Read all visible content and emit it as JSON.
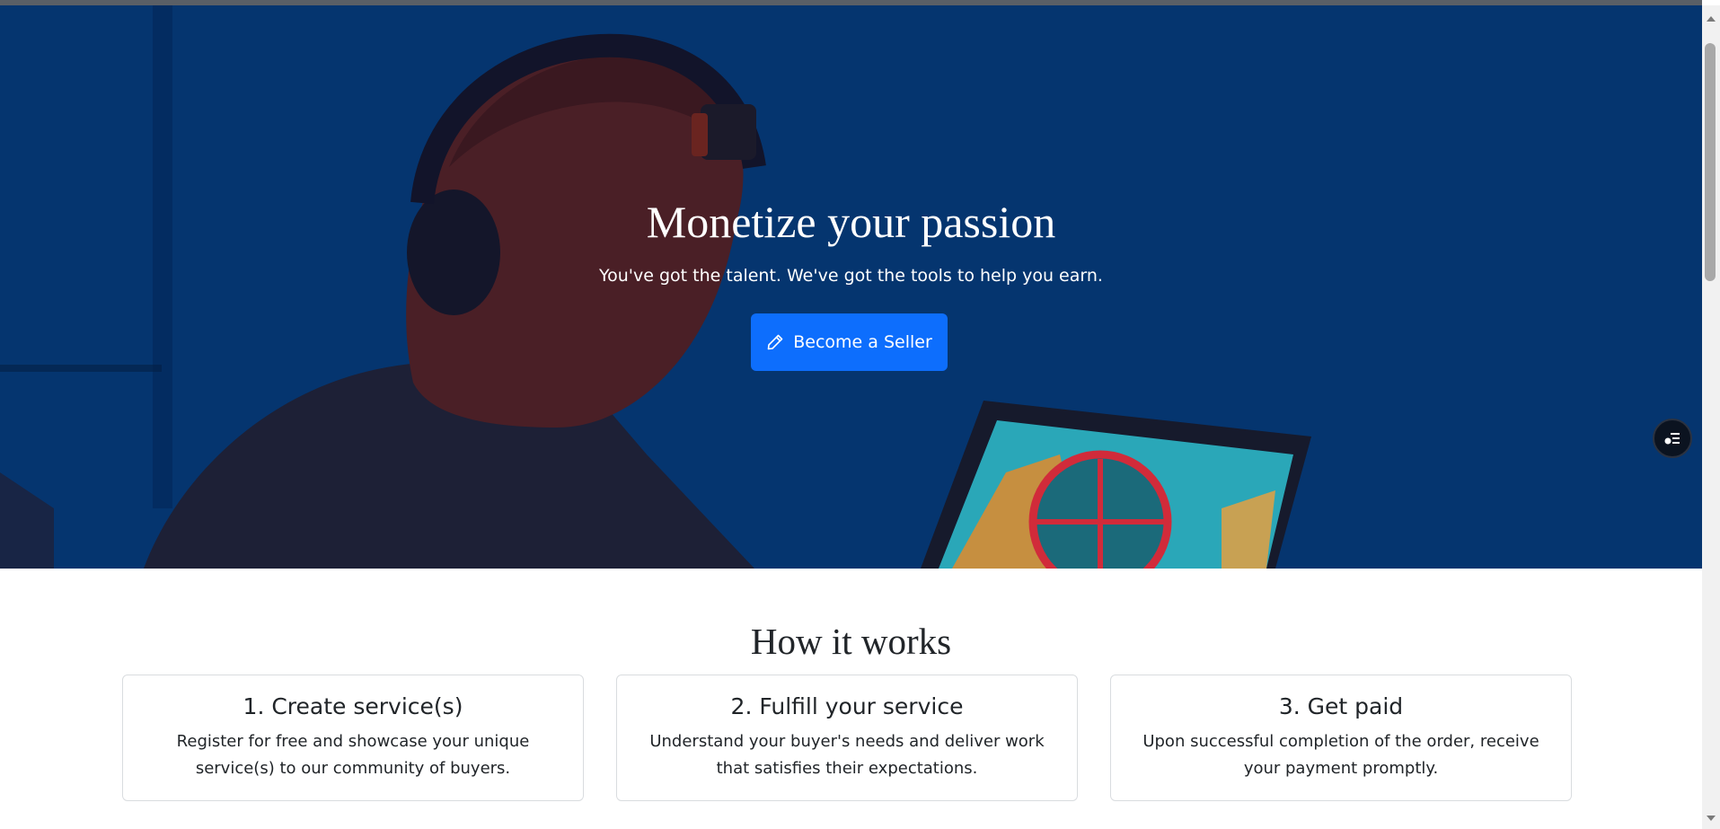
{
  "hero": {
    "title": "Monetize your passion",
    "subtitle": "You've got the talent. We've got the tools to help you earn.",
    "cta_label": "Become a Seller",
    "cta_icon": "pencil-icon"
  },
  "float_button": {
    "icon": "list-settings-icon"
  },
  "how_it_works": {
    "title": "How it works",
    "steps": [
      {
        "title": "1. Create service(s)",
        "text": "Register for free and showcase your unique service(s) to our community of buyers."
      },
      {
        "title": "2. Fulfill your service",
        "text": "Understand your buyer's needs and deliver work that satisfies their expectations."
      },
      {
        "title": "3. Get paid",
        "text": "Upon successful completion of the order, receive your payment promptly."
      }
    ]
  },
  "colors": {
    "primary": "#0d6efd",
    "hero_bg": "#063a78",
    "text": "#212529",
    "card_border": "#d9dcdf"
  }
}
